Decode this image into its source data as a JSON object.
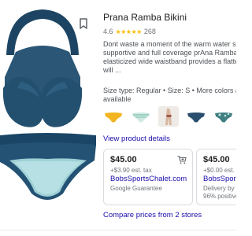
{
  "product": {
    "title": "Prana Ramba Bikini",
    "rating_value": "4.6",
    "stars": "★★★★★",
    "review_count": "268",
    "description_lines": [
      "Dont waste a moment of the warm water seaso",
      "supportive and full coverage prAna Ramba Bo",
      "elasticized wide waistband provides a flatterin",
      "will ..."
    ],
    "spec_lines": [
      "Size type: Regular • Size: S • More colors and",
      "available"
    ],
    "swatch_names": [
      "yellow-bottom",
      "mint-stripe-bottom",
      "figure-model",
      "navy-bottom",
      "teal-print-bottom",
      "blue-bottom"
    ],
    "view_details_label": "View product details"
  },
  "offers": [
    {
      "price": "$45.00",
      "tax": "+$3.90 est. tax",
      "store": "BobsSportsChalet.com",
      "note": "Google Guarantee",
      "note2": ""
    },
    {
      "price": "$45.00",
      "tax": "+$0.00 est. tax",
      "store": "BobsSports",
      "note": "Delivery by W",
      "note2": "96% positive"
    }
  ],
  "compare_label": "Compare prices from 2 stores",
  "colors": {
    "link": "#1a0dab",
    "navy": "#254f6e",
    "star": "#fbbc04"
  }
}
